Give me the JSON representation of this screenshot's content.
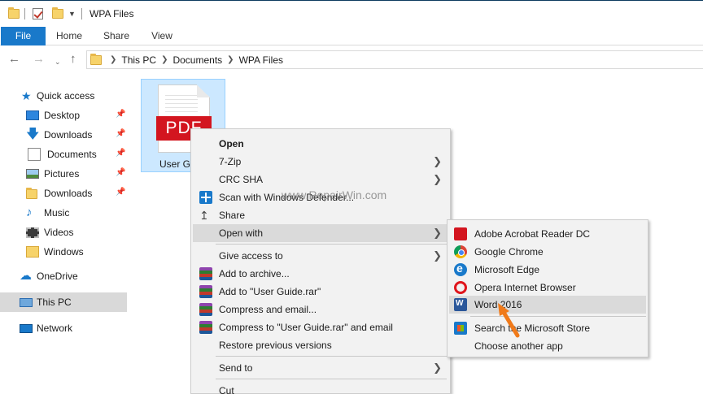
{
  "window": {
    "title": "WPA Files"
  },
  "ribbon": {
    "tabs": [
      "File",
      "Home",
      "Share",
      "View"
    ]
  },
  "address": {
    "crumbs": [
      "This PC",
      "Documents",
      "WPA Files"
    ]
  },
  "nav_pane": {
    "quick_access": "Quick access",
    "pinned": [
      {
        "label": "Desktop",
        "icon": "desktop-icon"
      },
      {
        "label": "Downloads",
        "icon": "download-icon"
      },
      {
        "label": "Documents",
        "icon": "documents-icon"
      },
      {
        "label": "Pictures",
        "icon": "pictures-icon"
      },
      {
        "label": "Downloads",
        "icon": "folder-icon"
      }
    ],
    "unpinned": [
      {
        "label": "Music",
        "icon": "music-icon"
      },
      {
        "label": "Videos",
        "icon": "videos-icon"
      },
      {
        "label": "Windows",
        "icon": "folder-icon"
      }
    ],
    "onedrive": "OneDrive",
    "this_pc": "This PC",
    "network": "Network"
  },
  "file": {
    "badge": "PDF",
    "name": "User Guide"
  },
  "context_menu": {
    "items": [
      {
        "label": "Open",
        "icon": "",
        "submenu": false
      },
      {
        "label": "7-Zip",
        "icon": "",
        "submenu": true
      },
      {
        "label": "CRC SHA",
        "icon": "",
        "submenu": true
      },
      {
        "label": "Scan with Windows Defender...",
        "icon": "defender-icon",
        "submenu": false
      },
      {
        "label": "Share",
        "icon": "share-icon",
        "submenu": false
      },
      {
        "label": "Open with",
        "icon": "",
        "submenu": true
      },
      {
        "label": "Give access to",
        "icon": "",
        "submenu": true
      },
      {
        "label": "Add to archive...",
        "icon": "winrar-icon",
        "submenu": false
      },
      {
        "label": "Add to \"User Guide.rar\"",
        "icon": "winrar-icon",
        "submenu": false
      },
      {
        "label": "Compress and email...",
        "icon": "winrar-icon",
        "submenu": false
      },
      {
        "label": "Compress to \"User Guide.rar\" and email",
        "icon": "winrar-icon",
        "submenu": false
      },
      {
        "label": "Restore previous versions",
        "icon": "",
        "submenu": false
      },
      {
        "label": "Send to",
        "icon": "",
        "submenu": true
      },
      {
        "label": "Cut",
        "icon": "",
        "submenu": false
      }
    ]
  },
  "open_with_menu": {
    "items": [
      {
        "label": "Adobe Acrobat Reader DC",
        "icon": "acrobat-icon"
      },
      {
        "label": "Google Chrome",
        "icon": "chrome-icon"
      },
      {
        "label": "Microsoft Edge",
        "icon": "edge-icon"
      },
      {
        "label": "Opera Internet Browser",
        "icon": "opera-icon"
      },
      {
        "label": "Word 2016",
        "icon": "word-icon"
      },
      {
        "label": "Search the Microsoft Store",
        "icon": "store-icon"
      },
      {
        "label": "Choose another app",
        "icon": ""
      }
    ]
  },
  "watermark": "www.RepairWin.com",
  "colors": {
    "accent": "#1979ca",
    "selection": "#cce8ff",
    "pdf_red": "#d3151f",
    "menu_bg": "#f2f2f2",
    "hover": "#dadada",
    "cursor_arrow": "#f07a1a"
  }
}
